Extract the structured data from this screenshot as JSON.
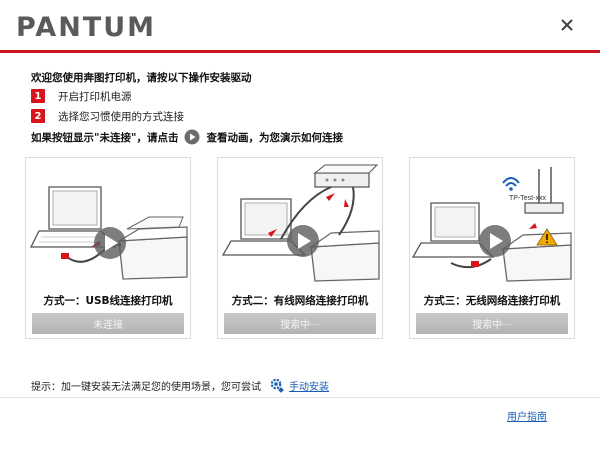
{
  "app": {
    "logo": "PANTUM"
  },
  "intro": "欢迎您使用奔图打印机，请按以下操作安装驱动",
  "steps": [
    {
      "num": "1",
      "text": "开启打印机电源"
    },
    {
      "num": "2",
      "text": "选择您习惯使用的方式连接"
    }
  ],
  "hint": {
    "prefix": "如果按钮显示\"未连接\"，请点击",
    "suffix": "查看动画，为您演示如何连接"
  },
  "cards": [
    {
      "title": "方式一：USB线连接打印机",
      "button": "未连接"
    },
    {
      "title": "方式二：有线网络连接打印机",
      "button": "搜索中···"
    },
    {
      "title": "方式三：无线网络连接打印机",
      "button": "搜索中···",
      "ssid": "TP-Test-xxx"
    }
  ],
  "footer": {
    "tip": "提示：加一键安装无法满足您的使用场景，您可尝试",
    "manual_link": "手动安装",
    "guide_link": "用户指南"
  },
  "colors": {
    "brand_red": "#c8161e",
    "step_red": "#d7141b",
    "link_blue": "#1a5fb4",
    "button_gray": "#bdbdbd"
  },
  "icons": [
    "close-icon",
    "play-icon",
    "gear-icon",
    "wifi-icon",
    "warning-icon"
  ]
}
